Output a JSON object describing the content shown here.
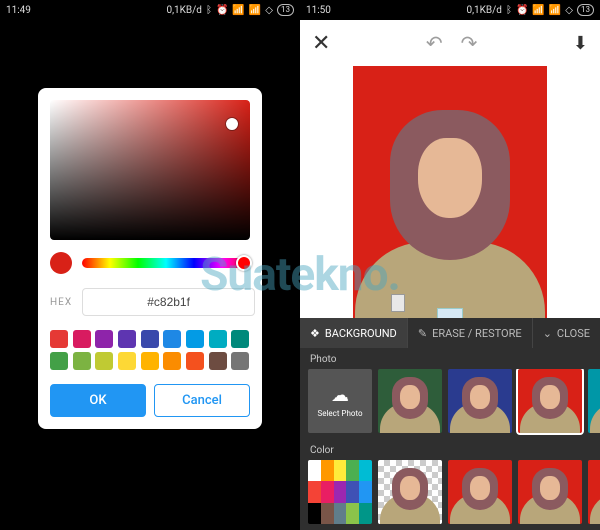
{
  "left": {
    "statusbar": {
      "time": "11:49",
      "net": "0,1KB/d",
      "battery": "13"
    },
    "picker": {
      "hex_label": "HEX",
      "hex_value": "#c82b1f",
      "preview_color": "#d82117",
      "ok_label": "OK",
      "cancel_label": "Cancel",
      "swatches": [
        "#e53935",
        "#d81b60",
        "#8e24aa",
        "#5e35b1",
        "#3949ab",
        "#1e88e5",
        "#039be5",
        "#00acc1",
        "#00897b",
        "#43a047",
        "#7cb342",
        "#c0ca33",
        "#fdd835",
        "#ffb300",
        "#fb8c00",
        "#f4511e",
        "#6d4c41",
        "#757575"
      ]
    }
  },
  "right": {
    "statusbar": {
      "time": "11:50",
      "net": "0,1KB/d",
      "battery": "13"
    },
    "editor": {
      "bg_color": "#d82117"
    },
    "panel": {
      "tab_background": "BACKGROUND",
      "tab_erase": "ERASE / RESTORE",
      "tab_close": "CLOSE",
      "section_photo": "Photo",
      "section_color": "Color",
      "upload_label": "Select Photo",
      "photo_bgs": [
        "#2e5d3a",
        "#2a3b8f",
        "#d82117",
        "#0097a7"
      ],
      "color_thumbs_bg": [
        "#d82117",
        "#d82117",
        "#d82117"
      ],
      "color_grid": [
        "#ffffff",
        "#ff9800",
        "#ffeb3b",
        "#4caf50",
        "#00bcd4",
        "#f44336",
        "#e91e63",
        "#9c27b0",
        "#3f51b5",
        "#2196f3",
        "#000000",
        "#795548",
        "#607d8b",
        "#8bc34a",
        "#009688"
      ]
    }
  },
  "watermark": "Suatekno"
}
